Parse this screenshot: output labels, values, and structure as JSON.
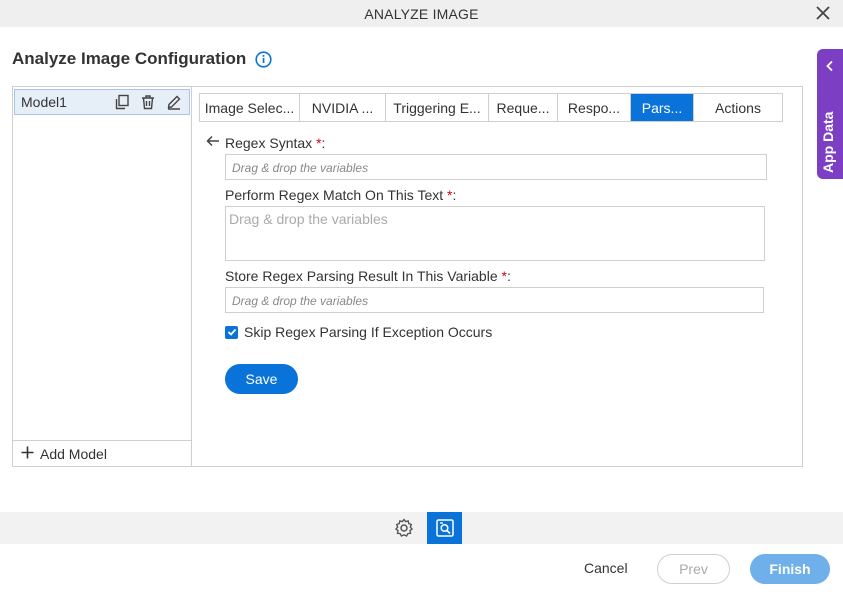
{
  "window": {
    "title": "ANALYZE IMAGE"
  },
  "page": {
    "title": "Analyze Image Configuration"
  },
  "models": {
    "items": [
      {
        "label": "Model1"
      }
    ],
    "add_label": "Add Model"
  },
  "tabs": [
    {
      "label": "Image Selec..."
    },
    {
      "label": "NVIDIA ..."
    },
    {
      "label": "Triggering E..."
    },
    {
      "label": "Reque..."
    },
    {
      "label": "Respo..."
    },
    {
      "label": "Pars...",
      "active": true
    },
    {
      "label": "Actions"
    }
  ],
  "form": {
    "regex_label": "Regex Syntax",
    "regex_placeholder": "Drag & drop the variables",
    "match_label": "Perform Regex Match On This Text",
    "match_placeholder": "Drag & drop the variables",
    "store_label": "Store Regex Parsing Result In This Variable",
    "store_placeholder": "Drag & drop the variables",
    "required_mark": "*",
    "colon": ":",
    "skip_label": "Skip Regex Parsing If Exception Occurs",
    "skip_checked": true,
    "save_label": "Save"
  },
  "side_panel": {
    "label": "App Data"
  },
  "footer": {
    "cancel_label": "Cancel",
    "prev_label": "Prev",
    "finish_label": "Finish"
  },
  "colors": {
    "accent": "#0a73d9",
    "app_data": "#7c3fc4",
    "required": "#d0021b",
    "finish_disabled": "#6fb0ea"
  },
  "icons": {
    "close": "close-icon",
    "info": "info-icon",
    "copy": "copy-icon",
    "delete": "trash-icon",
    "edit": "pencil-icon",
    "add": "plus-icon",
    "back": "arrow-left-icon",
    "app_data_toggle": "chevron-left-icon",
    "settings": "gear-icon",
    "image_analyze": "image-search-icon",
    "checkbox": "checkmark-icon"
  }
}
